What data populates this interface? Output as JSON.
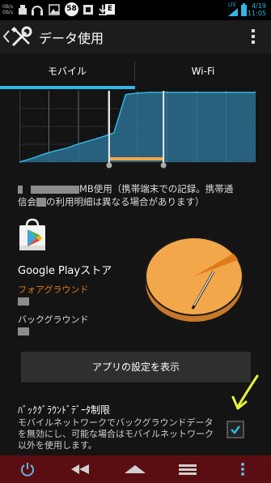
{
  "status_bar": {
    "left_small_top": "0B/s",
    "left_small_bottom": "0B/s",
    "badge_number": "58",
    "e_label": "E",
    "network_label": "LTE",
    "time": "11:05",
    "date": "4/19"
  },
  "action_bar": {
    "title": "データ使用",
    "icons": [
      "back-chevron-icon",
      "wrench-screwdriver-icon",
      "overflow-menu-icon"
    ]
  },
  "tabs": [
    "モバイル",
    "Wi-Fi"
  ],
  "chart_data": {
    "type": "area",
    "title": "",
    "xlabel": "",
    "ylabel": "",
    "colors": {
      "fill": "#2b6e8f",
      "line": "#33b5e5",
      "selection": "#f2a74a",
      "grid": "#6a6a6a"
    },
    "x": [
      0,
      0.05,
      0.1,
      0.15,
      0.2,
      0.25,
      0.3,
      0.35,
      0.4,
      0.45,
      0.5,
      0.55,
      0.6,
      0.65,
      0.7,
      0.75,
      0.8,
      0.85,
      0.9,
      0.95,
      1.0
    ],
    "series": [
      {
        "name": "",
        "values": [
          0.0,
          0.05,
          0.11,
          0.16,
          0.2,
          0.26,
          0.31,
          0.36,
          0.42,
          0.97,
          0.99,
          1.0,
          1.0,
          1.0,
          1.0,
          1.0,
          1.0,
          1.0,
          1.0,
          1.0,
          1.0
        ]
      }
    ],
    "selection": [
      0.38,
      0.61
    ],
    "ylim": [
      0,
      1
    ],
    "grid": true
  },
  "usage_note": {
    "line1_suffix": "MB使用（携帯端末での記録。携帯通",
    "line2_prefix": "信会",
    "line2_suffix": "の利用明細は異なる場合があります）"
  },
  "app": {
    "name": "Google Playストア",
    "foreground_label": "フォアグラウンド",
    "background_label": "バックグラウンド",
    "icon": "google-play-store-icon"
  },
  "pie": {
    "foreground_fraction": 0.03,
    "colors": {
      "main": "#f2a74a",
      "edge": "#c8782a",
      "slice": "#e07a1b"
    }
  },
  "buttons": {
    "app_settings": "アプリの設定を表示"
  },
  "background_restriction": {
    "title": "ﾊﾞｯｸｸﾞﾗｳﾝﾄﾞﾃﾞｰﾀ制限",
    "description": "モバイルネットワークでバックグラウンドデータを無効にし、可能な場合はモバイルネットワーク以外を使用します。",
    "checked": true
  },
  "navbar": {
    "icons": [
      "power-icon",
      "back-icon",
      "home-icon",
      "recent-apps-icon",
      "menu-icon"
    ]
  }
}
